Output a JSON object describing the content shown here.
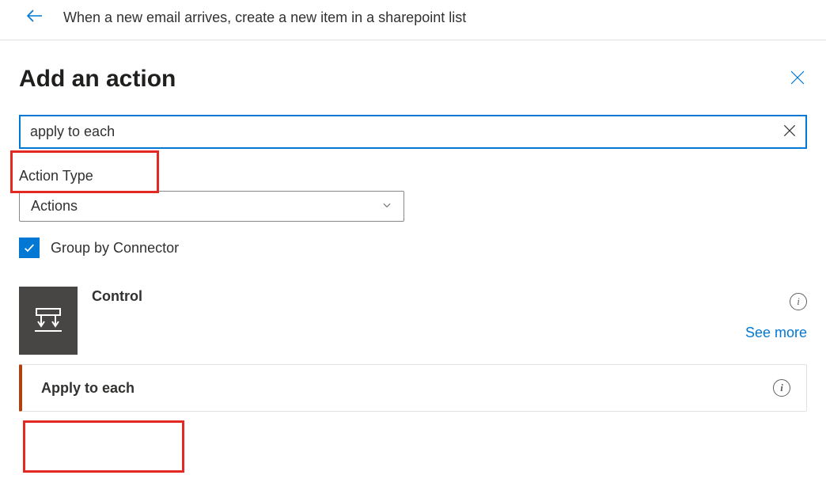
{
  "topbar": {
    "title": "When a new email arrives, create a new item in a sharepoint list"
  },
  "panel": {
    "heading": "Add an action"
  },
  "search": {
    "value": "apply to each"
  },
  "actionType": {
    "label": "Action Type",
    "selected": "Actions"
  },
  "groupBy": {
    "label": "Group by Connector",
    "checked": true
  },
  "connector": {
    "name": "Control",
    "seeMore": "See more"
  },
  "results": [
    {
      "label": "Apply to each"
    }
  ]
}
